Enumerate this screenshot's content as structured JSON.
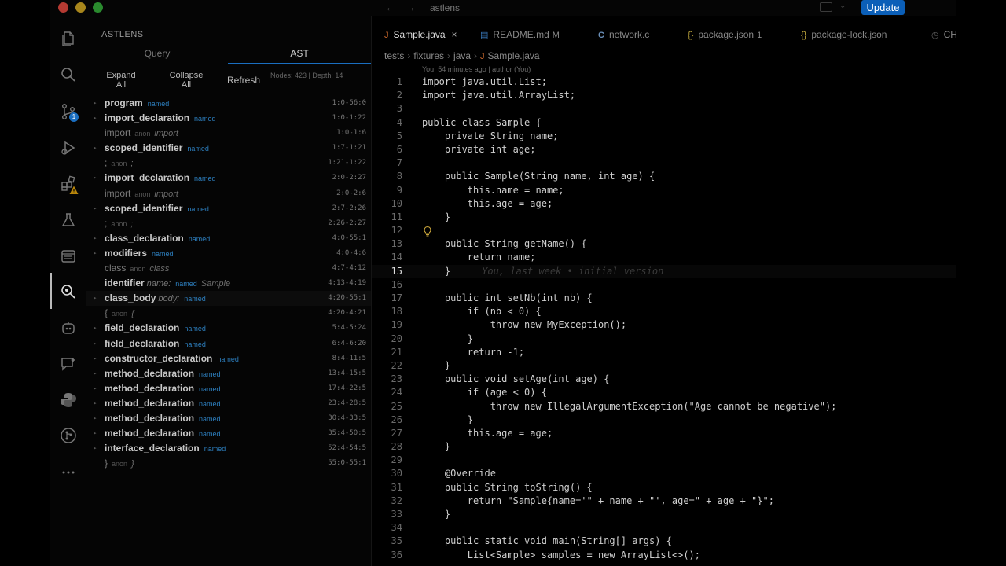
{
  "window": {
    "title": "astlens",
    "update_label": "Update"
  },
  "activity": {
    "scm_badge": "1"
  },
  "panel": {
    "title": "ASTLENS",
    "tabs": [
      "Query",
      "AST"
    ],
    "expand_label": "Expand All",
    "collapse_label": "Collapse All",
    "refresh_label": "Refresh",
    "stats": "Nodes: 423 | Depth: 14"
  },
  "ast": [
    {
      "type": "program",
      "named": true,
      "range": "1:0-56:0",
      "caret": true
    },
    {
      "type": "import_declaration",
      "named": true,
      "range": "1:0-1:22",
      "caret": true
    },
    {
      "type": "import",
      "named": false,
      "text": "import",
      "range": "1:0-1:6",
      "caret": false
    },
    {
      "type": "scoped_identifier",
      "named": true,
      "range": "1:7-1:21",
      "caret": true
    },
    {
      "type": ";",
      "named": false,
      "text": ";",
      "range": "1:21-1:22",
      "caret": false
    },
    {
      "type": "import_declaration",
      "named": true,
      "range": "2:0-2:27",
      "caret": true
    },
    {
      "type": "import",
      "named": false,
      "text": "import",
      "range": "2:0-2:6",
      "caret": false
    },
    {
      "type": "scoped_identifier",
      "named": true,
      "range": "2:7-2:26",
      "caret": true
    },
    {
      "type": ";",
      "named": false,
      "text": ";",
      "range": "2:26-2:27",
      "caret": false
    },
    {
      "type": "class_declaration",
      "named": true,
      "range": "4:0-55:1",
      "caret": true
    },
    {
      "type": "modifiers",
      "named": true,
      "range": "4:0-4:6",
      "caret": true
    },
    {
      "type": "class",
      "named": false,
      "text": "class",
      "range": "4:7-4:12",
      "caret": false
    },
    {
      "type": "identifier",
      "field": "name:",
      "named": true,
      "text": "Sample",
      "range": "4:13-4:19",
      "caret": false
    },
    {
      "type": "class_body",
      "field": "body:",
      "named": true,
      "range": "4:20-55:1",
      "caret": true,
      "selected": true
    },
    {
      "type": "{",
      "named": false,
      "text": "{",
      "range": "4:20-4:21",
      "caret": false
    },
    {
      "type": "field_declaration",
      "named": true,
      "range": "5:4-5:24",
      "caret": true
    },
    {
      "type": "field_declaration",
      "named": true,
      "range": "6:4-6:20",
      "caret": true
    },
    {
      "type": "constructor_declaration",
      "named": true,
      "range": "8:4-11:5",
      "caret": true
    },
    {
      "type": "method_declaration",
      "named": true,
      "range": "13:4-15:5",
      "caret": true
    },
    {
      "type": "method_declaration",
      "named": true,
      "range": "17:4-22:5",
      "caret": true
    },
    {
      "type": "method_declaration",
      "named": true,
      "range": "23:4-28:5",
      "caret": true
    },
    {
      "type": "method_declaration",
      "named": true,
      "range": "30:4-33:5",
      "caret": true
    },
    {
      "type": "method_declaration",
      "named": true,
      "range": "35:4-50:5",
      "caret": true
    },
    {
      "type": "interface_declaration",
      "named": true,
      "range": "52:4-54:5",
      "caret": true
    },
    {
      "type": "}",
      "named": false,
      "text": "}",
      "range": "55:0-55:1",
      "caret": false
    }
  ],
  "ast_labels": {
    "named": "named",
    "anon": "anon"
  },
  "tabs": [
    {
      "icon": "J",
      "label": "Sample.java",
      "close": "×"
    },
    {
      "icon": "▤",
      "label": "README.md",
      "mod": "M"
    },
    {
      "icon": "C",
      "label": "network.c"
    },
    {
      "icon": "{}",
      "label": "package.json",
      "mod": "1"
    },
    {
      "icon": "{}",
      "label": "package-lock.json"
    },
    {
      "icon": "◷",
      "label": "CH"
    }
  ],
  "breadcrumb": [
    "tests",
    "fixtures",
    "java",
    "Sample.java"
  ],
  "blame_top": "You, 54 minutes ago | author (You)",
  "blame_inline": "You, last week • initial version",
  "current_line": 15,
  "code": [
    "import java.util.List;",
    "import java.util.ArrayList;",
    "",
    "public class Sample {",
    "    private String name;",
    "    private int age;",
    "",
    "    public Sample(String name, int age) {",
    "        this.name = name;",
    "        this.age = age;",
    "    }",
    "",
    "    public String getName() {",
    "        return name;",
    "    }",
    "",
    "    public int setNb(int nb) {",
    "        if (nb < 0) {",
    "            throw new MyException();",
    "        }",
    "        return -1;",
    "    }",
    "    public void setAge(int age) {",
    "        if (age < 0) {",
    "            throw new IllegalArgumentException(\"Age cannot be negative\");",
    "        }",
    "        this.age = age;",
    "    }",
    "",
    "    @Override",
    "    public String toString() {",
    "        return \"Sample{name='\" + name + \"', age=\" + age + \"}\";",
    "    }",
    "",
    "    public static void main(String[] args) {",
    "        List<Sample> samples = new ArrayList<>();"
  ]
}
